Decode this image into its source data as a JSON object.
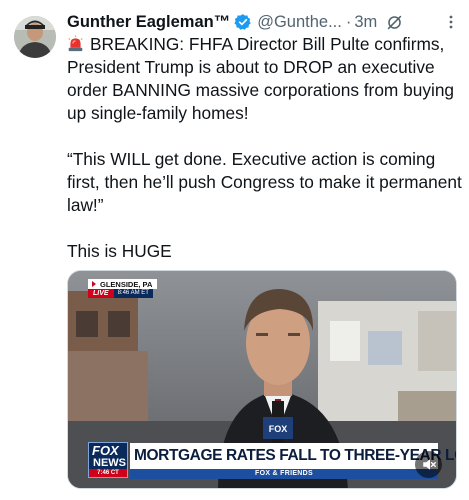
{
  "tweet": {
    "author_name": "Gunther Eagleman™",
    "handle": "@Gunthe...",
    "separator": "·",
    "time_ago": "3m",
    "paragraphs": [
      "BREAKING: FHFA Director Bill Pulte confirms, President Trump is about to DROP an executive order BANNING massive corporations from buying up single-family homes!",
      "“This WILL get done. Executive action is coming first, then he’ll push Congress to make it permanent law!”",
      "This is HUGE"
    ]
  },
  "video": {
    "location": "GLENSIDE, PA",
    "live_label": "LIVE",
    "live_time": "8:46 AM ET",
    "network_line1": "FOX",
    "network_line2": "NEWS",
    "clock": "7:46 CT",
    "headline": "MORTGAGE RATES FALL TO THREE-YEAR LOWS",
    "show_name": "FOX & FRIENDS",
    "mic_flag": "FOX"
  },
  "icons": {
    "verified": "verified-badge-icon",
    "grok": "grok-icon",
    "more": "more-dots-icon",
    "siren": "siren-emoji-icon",
    "mute": "speaker-muted-icon"
  },
  "colors": {
    "verified_blue": "#1d9bf0",
    "secondary_text": "#536471",
    "fox_red": "#d0021b",
    "fox_navy": "#0b2a5c"
  }
}
